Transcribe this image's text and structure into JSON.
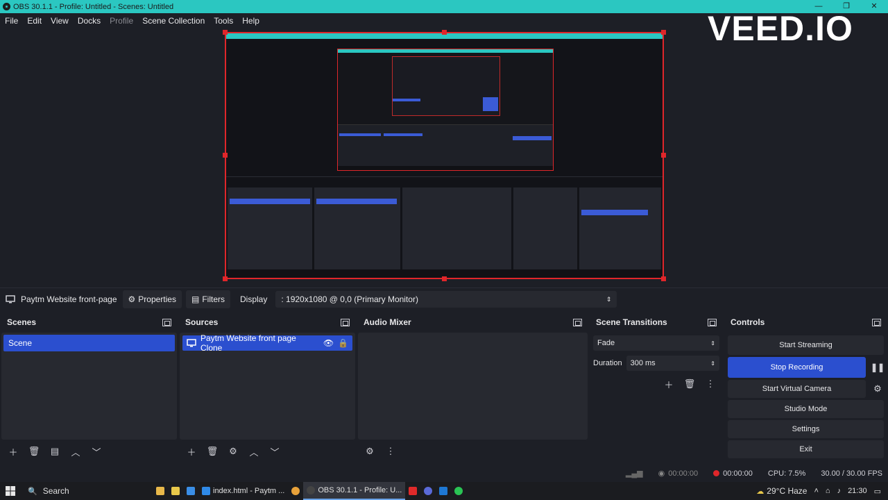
{
  "window": {
    "title": "OBS 30.1.1 - Profile: Untitled - Scenes: Untitled",
    "minimize": "—",
    "maximize": "❐",
    "close": "✕"
  },
  "menu": [
    "File",
    "Edit",
    "View",
    "Docks",
    "Profile",
    "Scene Collection",
    "Tools",
    "Help"
  ],
  "watermark": "VEED.IO",
  "toolbar": {
    "source_name": "Paytm Website front-page",
    "properties": "Properties",
    "filters": "Filters",
    "display_label": "Display",
    "display_value": ": 1920x1080 @ 0,0 (Primary Monitor)"
  },
  "scenes": {
    "title": "Scenes",
    "items": [
      "Scene"
    ]
  },
  "sources": {
    "title": "Sources",
    "items": [
      "Paytm Website front page Clone"
    ]
  },
  "audio_mixer": {
    "title": "Audio Mixer"
  },
  "transitions": {
    "title": "Scene Transitions",
    "transition": "Fade",
    "duration_label": "Duration",
    "duration_value": "300 ms"
  },
  "controls": {
    "title": "Controls",
    "start_streaming": "Start Streaming",
    "stop_recording": "Stop Recording",
    "start_virtual_camera": "Start Virtual Camera",
    "studio_mode": "Studio Mode",
    "settings": "Settings",
    "exit": "Exit"
  },
  "status": {
    "stream_time": "00:00:00",
    "rec_time": "00:00:00",
    "cpu": "CPU: 7.5%",
    "fps": "30.00 / 30.00 FPS"
  },
  "taskbar": {
    "search": "Search",
    "app_vscode": "index.html - Paytm ...",
    "app_obs": "OBS 30.1.1 - Profile: U...",
    "weather": "29°C Haze",
    "time": "21:30"
  },
  "colors": {
    "accent": "#2b4fcf",
    "titlebar": "#2bc7c1",
    "record": "#e0262a"
  }
}
